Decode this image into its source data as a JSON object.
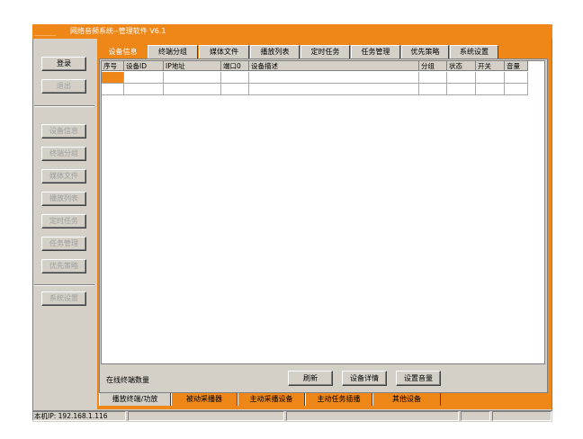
{
  "window": {
    "title": "网络音频系统--管理软件 V6.1"
  },
  "left_menu": {
    "login": "登录",
    "logout": "退出",
    "items": [
      "设备信息",
      "终端分组",
      "媒体文件",
      "播放列表",
      "定时任务",
      "任务管理",
      "优先策略"
    ],
    "settings": "系统设置"
  },
  "tabs": [
    "设备信息",
    "终端分组",
    "媒体文件",
    "播放列表",
    "定时任务",
    "任务管理",
    "优先策略",
    "系统设置"
  ],
  "table": {
    "columns": [
      "序号",
      "设备ID",
      "IP地址",
      "端口0",
      "设备描述",
      "分组",
      "状态",
      "开关",
      "音量"
    ],
    "rows": [
      [
        "",
        "",
        "",
        "",
        "",
        "",
        "",
        "",
        ""
      ],
      [
        "",
        "",
        "",
        "",
        "",
        "",
        "",
        "",
        ""
      ]
    ]
  },
  "actions": {
    "online_label": "在线终端数量",
    "refresh": "刷新",
    "device_detail": "设备详情",
    "set_volume": "设置音量"
  },
  "bottom_tabs": [
    "播放终端/功放",
    "被动采播器",
    "主动采播设备",
    "主动任务插播",
    "其他设备"
  ],
  "status_bar": {
    "local_ip": "本机IP: 192.168.1.116"
  },
  "colors": {
    "accent": "#ee8618",
    "face": "#d4d0c8"
  }
}
